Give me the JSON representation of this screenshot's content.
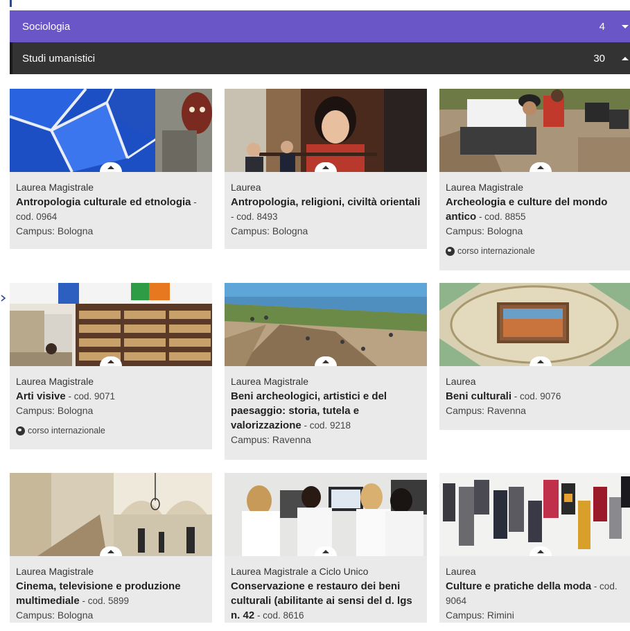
{
  "accordion": [
    {
      "label": "Sociologia",
      "count": "4",
      "state": "collapsed",
      "color": "#6b56c8"
    },
    {
      "label": "Studi umanistici",
      "count": "30",
      "state": "expanded",
      "color": "#333333"
    }
  ],
  "courses": [
    {
      "type": "Laurea Magistrale",
      "title": "Antropologia culturale ed etnologia",
      "cod": " - cod. 0964",
      "campus": "Campus: Bologna",
      "international": ""
    },
    {
      "type": "Laurea",
      "title": "Antropologia, religioni, civiltà orientali",
      "cod": " - cod. 8493",
      "campus": "Campus: Bologna",
      "international": ""
    },
    {
      "type": "Laurea Magistrale",
      "title": "Archeologia e culture del mondo antico",
      "cod": " - cod. 8855",
      "campus": "Campus: Bologna",
      "international": "corso internazionale"
    },
    {
      "type": "Laurea Magistrale",
      "title": "Arti visive",
      "cod": " - cod. 9071",
      "campus": "Campus: Bologna",
      "international": "corso internazionale"
    },
    {
      "type": "Laurea Magistrale",
      "title": "Beni archeologici, artistici e del paesaggio: storia, tutela e valorizzazione",
      "cod": " - cod. 9218",
      "campus": "Campus: Ravenna",
      "international": ""
    },
    {
      "type": "Laurea",
      "title": "Beni culturali",
      "cod": " - cod. 9076",
      "campus": "Campus: Ravenna",
      "international": ""
    },
    {
      "type": "Laurea Magistrale",
      "title": "Cinema, televisione e produzione multimediale",
      "cod": " - cod. 5899",
      "campus": "Campus: Bologna",
      "international": ""
    },
    {
      "type": "Laurea Magistrale a Ciclo Unico",
      "title": "Conservazione e restauro dei beni culturali (abilitante ai sensi del d. lgs n. 42",
      "cod": " - cod. 8616",
      "campus": "",
      "international": ""
    },
    {
      "type": "Laurea",
      "title": "Culture e pratiche della moda",
      "cod": " - cod. 9064",
      "campus": "Campus: Rimini",
      "international": ""
    }
  ]
}
